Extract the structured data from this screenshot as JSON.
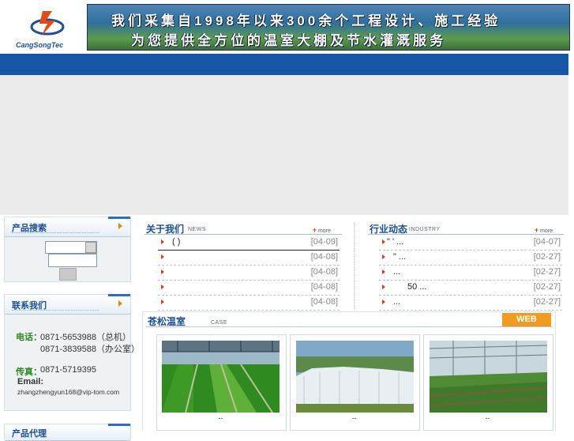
{
  "header": {
    "logo_text": "CangSongTec",
    "banner_line1": "我们采集自1998年以来300余个工程设计、施工经验",
    "banner_line2": "为您提供全方位的温室大棚及节水灌溉服务"
  },
  "sidebar": {
    "search_title": "产品搜索",
    "contact_title": "联系我们",
    "agent_title": "产品代理",
    "contact": {
      "phone_label": "电话：",
      "phone1": "0871-5653988（总机）",
      "phone2": "0871-3839588（办公室）",
      "fax_label": "传真：",
      "fax": "0871-5719395",
      "email_label": "Email:",
      "email": "zhangzhengyun168@vip-tom.com"
    }
  },
  "about": {
    "title": "关于我们",
    "en": "NEWS",
    "more": "more",
    "items": [
      {
        "text": "(    )",
        "date": "[04-09]"
      },
      {
        "text": "",
        "date": "[04-08]"
      },
      {
        "text": "",
        "date": "[04-08]"
      },
      {
        "text": "",
        "date": "[04-08]"
      },
      {
        "text": "",
        "date": "[04-08]"
      }
    ]
  },
  "industry": {
    "title": "行业动态",
    "en": "INDUSTRY",
    "more": "more",
    "items": [
      {
        "text": "\"  '          ...",
        "date": "[04-07]"
      },
      {
        "text": "   \"          ...",
        "date": "[02-27]"
      },
      {
        "text": "              ...",
        "date": "[02-27]"
      },
      {
        "text": "     50    ...",
        "date": "[02-27]"
      },
      {
        "text": "              ...",
        "date": "[02-27]"
      }
    ]
  },
  "products": {
    "title": "苍松温室",
    "en": "CASE",
    "web_label": "WEB",
    "items": [
      {
        "caption": "--"
      },
      {
        "caption": "--"
      },
      {
        "caption": "--"
      }
    ]
  },
  "colors": {
    "nav": "#1856a7",
    "accent": "#f29c1f",
    "title": "#1a4f96"
  }
}
